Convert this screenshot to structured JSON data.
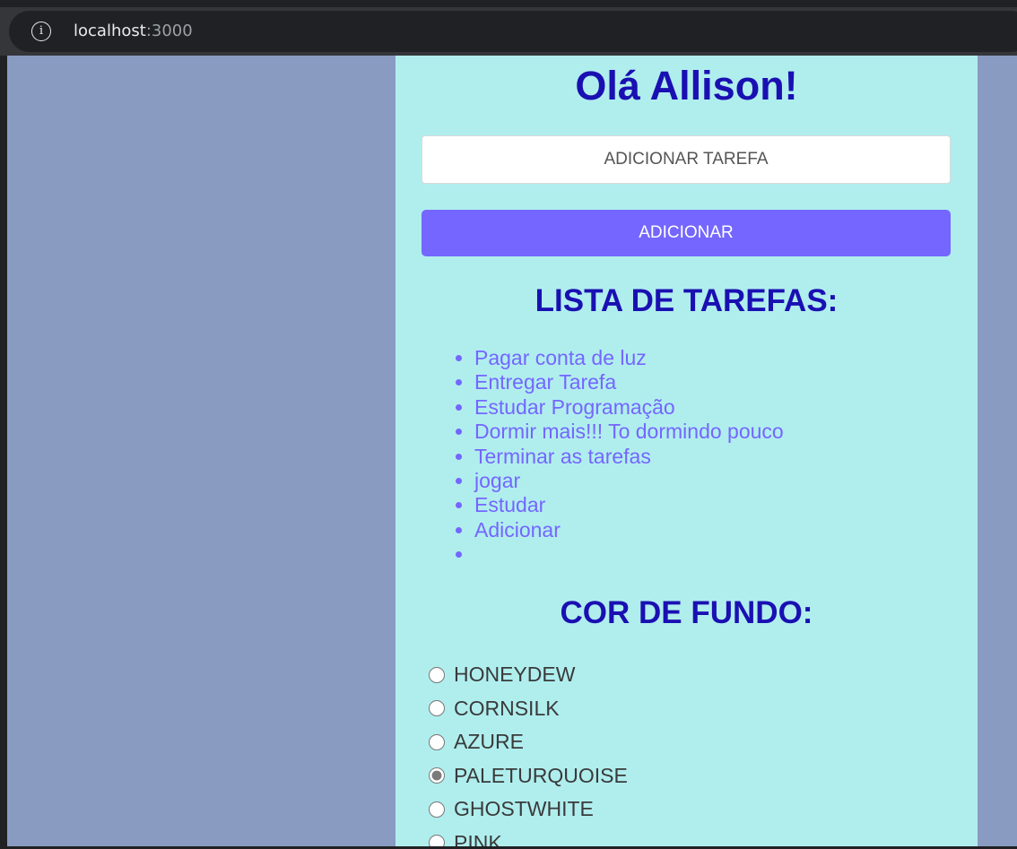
{
  "browser": {
    "host": "localhost",
    "port": ":3000"
  },
  "header": {
    "greeting": "Olá Allison!"
  },
  "form": {
    "input_placeholder": "ADICIONAR TAREFA",
    "input_value": "",
    "add_label": "ADICIONAR"
  },
  "tasks": {
    "title": "LISTA DE TAREFAS:",
    "items": [
      "Pagar conta de luz",
      "Entregar Tarefa",
      "Estudar Programação",
      "Dormir mais!!! To dormindo pouco",
      "Terminar as tarefas",
      "jogar",
      "Estudar",
      "Adicionar",
      ""
    ]
  },
  "background_color": {
    "title": "COR DE FUNDO:",
    "selected": "PALETURQUOISE",
    "options": [
      "HONEYDEW",
      "CORNSILK",
      "AZURE",
      "PALETURQUOISE",
      "GHOSTWHITE",
      "PINK"
    ]
  },
  "colors": {
    "page_background": "#8a9bc2",
    "panel_background": "#b0eeee",
    "heading": "#1a10b2",
    "accent": "#7466ff"
  }
}
